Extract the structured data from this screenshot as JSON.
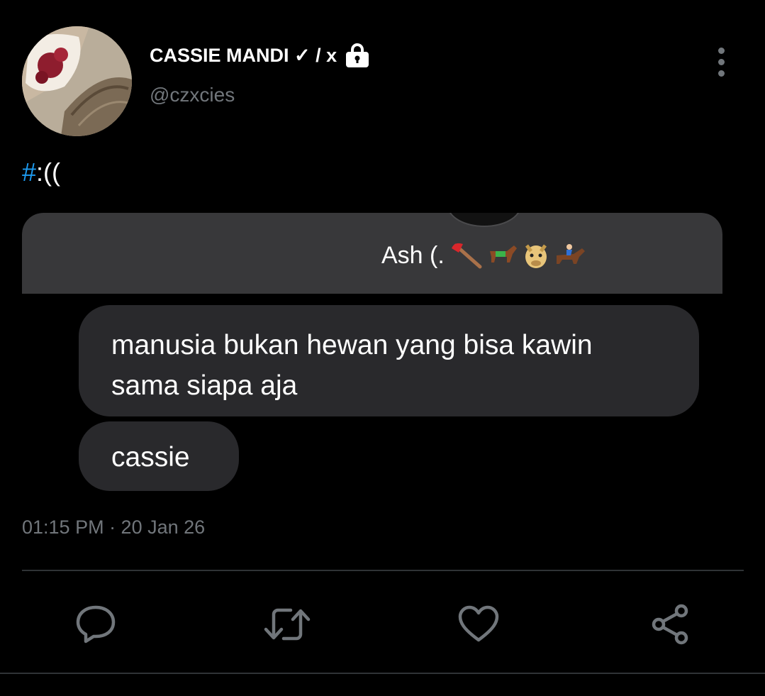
{
  "author": {
    "display_name": "CASSIE MANDI ✓ / x",
    "handle": "@czxcies",
    "avatar_icon": "avatar-photo",
    "badge_icon": "lock-icon"
  },
  "tweet": {
    "hashtag": "#",
    "text": ":(("
  },
  "media": {
    "contact_name": "Ash (.",
    "contact_emojis": [
      "axe-icon",
      "horse-icon",
      "horse-face-icon",
      "horse-racing-icon"
    ],
    "messages": [
      "manusia bukan hewan yang bisa kawin sama siapa aja",
      "cassie"
    ]
  },
  "meta": {
    "timestamp": "01:15 PM · 20 Jan 26"
  },
  "actions": [
    {
      "name": "reply",
      "icon": "reply-icon"
    },
    {
      "name": "retweet",
      "icon": "retweet-icon"
    },
    {
      "name": "like",
      "icon": "heart-icon"
    },
    {
      "name": "share",
      "icon": "share-icon"
    }
  ],
  "colors": {
    "background": "#000000",
    "accent": "#1d9bf0",
    "muted": "#71767b",
    "bubble": "#29292c",
    "chat_header": "#38383a"
  }
}
